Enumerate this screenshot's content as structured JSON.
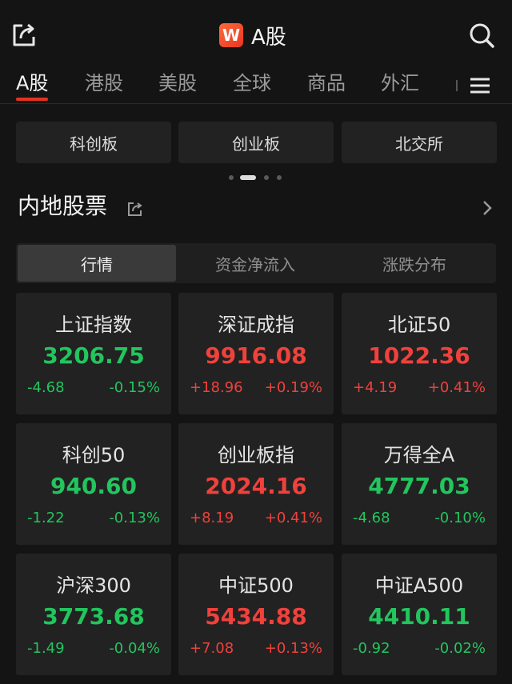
{
  "header": {
    "title": "A股",
    "logo_text": "W",
    "logo_color": "#e8361e",
    "left_icon": "share-icon",
    "right_icon": "search-icon"
  },
  "tabs": [
    {
      "label": "A股",
      "active": true
    },
    {
      "label": "港股",
      "active": false
    },
    {
      "label": "美股",
      "active": false
    },
    {
      "label": "全球",
      "active": false
    },
    {
      "label": "商品",
      "active": false
    },
    {
      "label": "外汇",
      "active": false
    }
  ],
  "menu_icon": "menu-icon",
  "quick_links": [
    "科创板",
    "创业板",
    "北交所"
  ],
  "pager": {
    "count": 4,
    "active_index": 1
  },
  "section": {
    "title": "内地股票",
    "link_icon": "external-link-icon",
    "chevron_icon": "chevron-right-icon"
  },
  "segments": [
    {
      "label": "行情",
      "active": true
    },
    {
      "label": "资金净流入",
      "active": false
    },
    {
      "label": "涨跌分布",
      "active": false
    }
  ],
  "colors": {
    "up": "#f0413c",
    "down": "#22c55e",
    "accent": "#e8321f"
  },
  "indices": [
    {
      "name": "上证指数",
      "value": "3206.75",
      "change": "-4.68",
      "pct": "-0.15%",
      "trend": "down"
    },
    {
      "name": "深证成指",
      "value": "9916.08",
      "change": "+18.96",
      "pct": "+0.19%",
      "trend": "up"
    },
    {
      "name": "北证50",
      "value": "1022.36",
      "change": "+4.19",
      "pct": "+0.41%",
      "trend": "up"
    },
    {
      "name": "科创50",
      "value": "940.60",
      "change": "-1.22",
      "pct": "-0.13%",
      "trend": "down"
    },
    {
      "name": "创业板指",
      "value": "2024.16",
      "change": "+8.19",
      "pct": "+0.41%",
      "trend": "up"
    },
    {
      "name": "万得全A",
      "value": "4777.03",
      "change": "-4.68",
      "pct": "-0.10%",
      "trend": "down"
    },
    {
      "name": "沪深300",
      "value": "3773.68",
      "change": "-1.49",
      "pct": "-0.04%",
      "trend": "down"
    },
    {
      "name": "中证500",
      "value": "5434.88",
      "change": "+7.08",
      "pct": "+0.13%",
      "trend": "up"
    },
    {
      "name": "中证A500",
      "value": "4410.11",
      "change": "-0.92",
      "pct": "-0.02%",
      "trend": "down"
    }
  ]
}
